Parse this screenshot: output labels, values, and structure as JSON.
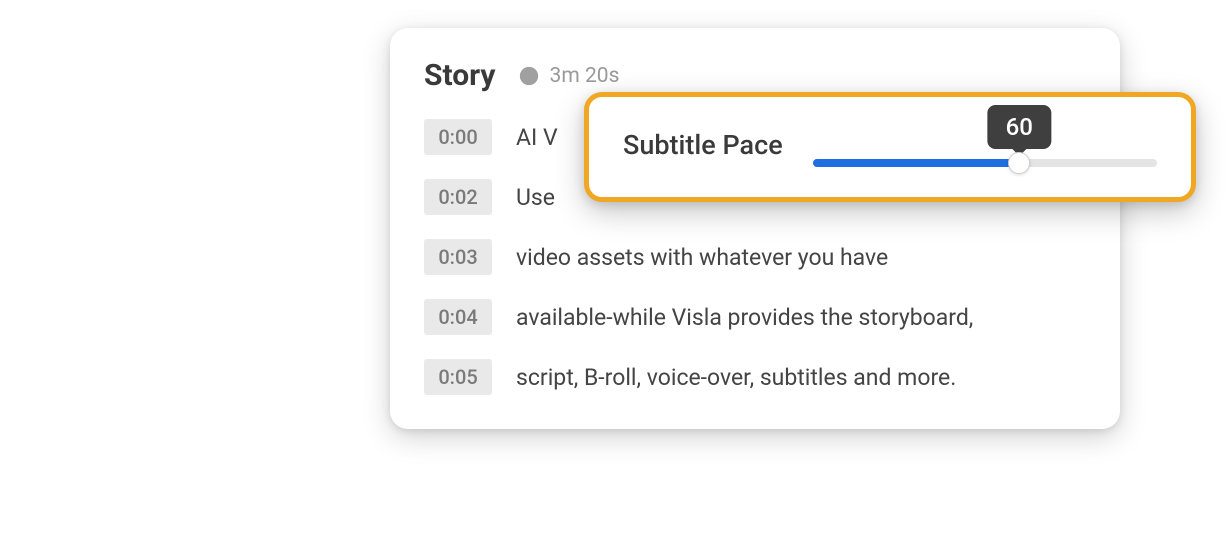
{
  "story": {
    "title": "Story",
    "duration": "3m 20s",
    "rows": [
      {
        "time": "0:00",
        "text": "AI V"
      },
      {
        "time": "0:02",
        "text": "Use"
      },
      {
        "time": "0:03",
        "text": "video assets with whatever you have"
      },
      {
        "time": "0:04",
        "text": "available-while Visla provides the storyboard,"
      },
      {
        "time": "0:05",
        "text": "script, B-roll, voice-over, subtitles and more."
      }
    ]
  },
  "pace": {
    "label": "Subtitle Pace",
    "value": "60",
    "percent": 60
  }
}
